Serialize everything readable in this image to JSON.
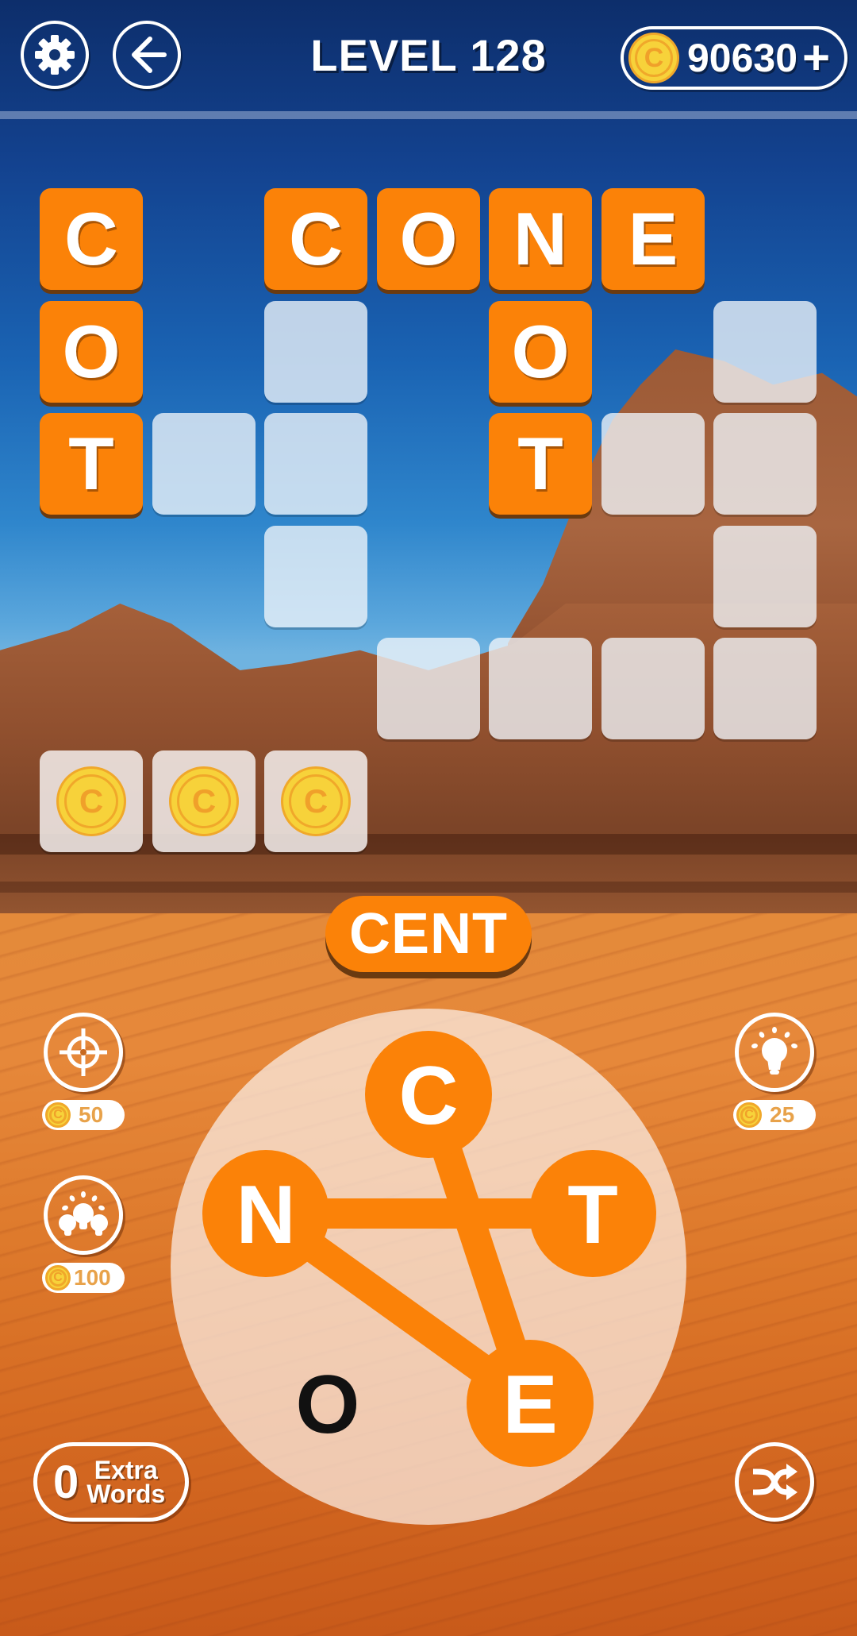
{
  "header": {
    "settings_icon": "gear-icon",
    "back_icon": "arrow-left-icon",
    "level_title": "LEVEL 128",
    "coins": "90630",
    "coin_symbol": "C",
    "add_coins_label": "+"
  },
  "grid": {
    "columns": 7,
    "rows": 6,
    "cells": [
      {
        "row": 0,
        "col": 0,
        "state": "filled",
        "letter": "C"
      },
      {
        "row": 0,
        "col": 2,
        "state": "filled",
        "letter": "C"
      },
      {
        "row": 0,
        "col": 3,
        "state": "filled",
        "letter": "O"
      },
      {
        "row": 0,
        "col": 4,
        "state": "filled",
        "letter": "N"
      },
      {
        "row": 0,
        "col": 5,
        "state": "filled",
        "letter": "E"
      },
      {
        "row": 1,
        "col": 0,
        "state": "filled",
        "letter": "O"
      },
      {
        "row": 1,
        "col": 2,
        "state": "empty",
        "letter": ""
      },
      {
        "row": 1,
        "col": 4,
        "state": "filled",
        "letter": "O"
      },
      {
        "row": 1,
        "col": 6,
        "state": "empty",
        "letter": ""
      },
      {
        "row": 2,
        "col": 0,
        "state": "filled",
        "letter": "T"
      },
      {
        "row": 2,
        "col": 1,
        "state": "empty",
        "letter": ""
      },
      {
        "row": 2,
        "col": 2,
        "state": "empty",
        "letter": ""
      },
      {
        "row": 2,
        "col": 4,
        "state": "filled",
        "letter": "T"
      },
      {
        "row": 2,
        "col": 5,
        "state": "empty",
        "letter": ""
      },
      {
        "row": 2,
        "col": 6,
        "state": "empty",
        "letter": ""
      },
      {
        "row": 3,
        "col": 2,
        "state": "empty",
        "letter": ""
      },
      {
        "row": 3,
        "col": 6,
        "state": "empty",
        "letter": ""
      },
      {
        "row": 4,
        "col": 3,
        "state": "empty",
        "letter": ""
      },
      {
        "row": 4,
        "col": 4,
        "state": "empty",
        "letter": ""
      },
      {
        "row": 4,
        "col": 5,
        "state": "empty",
        "letter": ""
      },
      {
        "row": 4,
        "col": 6,
        "state": "empty",
        "letter": ""
      },
      {
        "row": 5,
        "col": 0,
        "state": "coin",
        "letter": "C"
      },
      {
        "row": 5,
        "col": 1,
        "state": "coin",
        "letter": "C"
      },
      {
        "row": 5,
        "col": 2,
        "state": "coin",
        "letter": "C"
      }
    ]
  },
  "current_word": "CENT",
  "powerups": {
    "target": {
      "icon": "crosshair-icon",
      "cost": "50"
    },
    "multi_hint": {
      "icon": "multi-bulb-icon",
      "cost": "100"
    },
    "hint": {
      "icon": "lightbulb-icon",
      "cost": "25"
    }
  },
  "wheel": {
    "letters": [
      {
        "id": "C",
        "letter": "C",
        "selected": true
      },
      {
        "id": "N",
        "letter": "N",
        "selected": true
      },
      {
        "id": "T",
        "letter": "T",
        "selected": true
      },
      {
        "id": "E",
        "letter": "E",
        "selected": true
      },
      {
        "id": "O",
        "letter": "O",
        "selected": false
      }
    ],
    "path": [
      "C",
      "E",
      "N",
      "T"
    ]
  },
  "extra_words": {
    "count": "0",
    "label_line1": "Extra",
    "label_line2": "Words"
  },
  "shuffle": {
    "icon": "shuffle-icon"
  },
  "colors": {
    "accent": "#fb8208",
    "coin_gold": "#f7d23a",
    "coin_ring": "#f0a82a",
    "cost_text": "#e8a24a"
  }
}
